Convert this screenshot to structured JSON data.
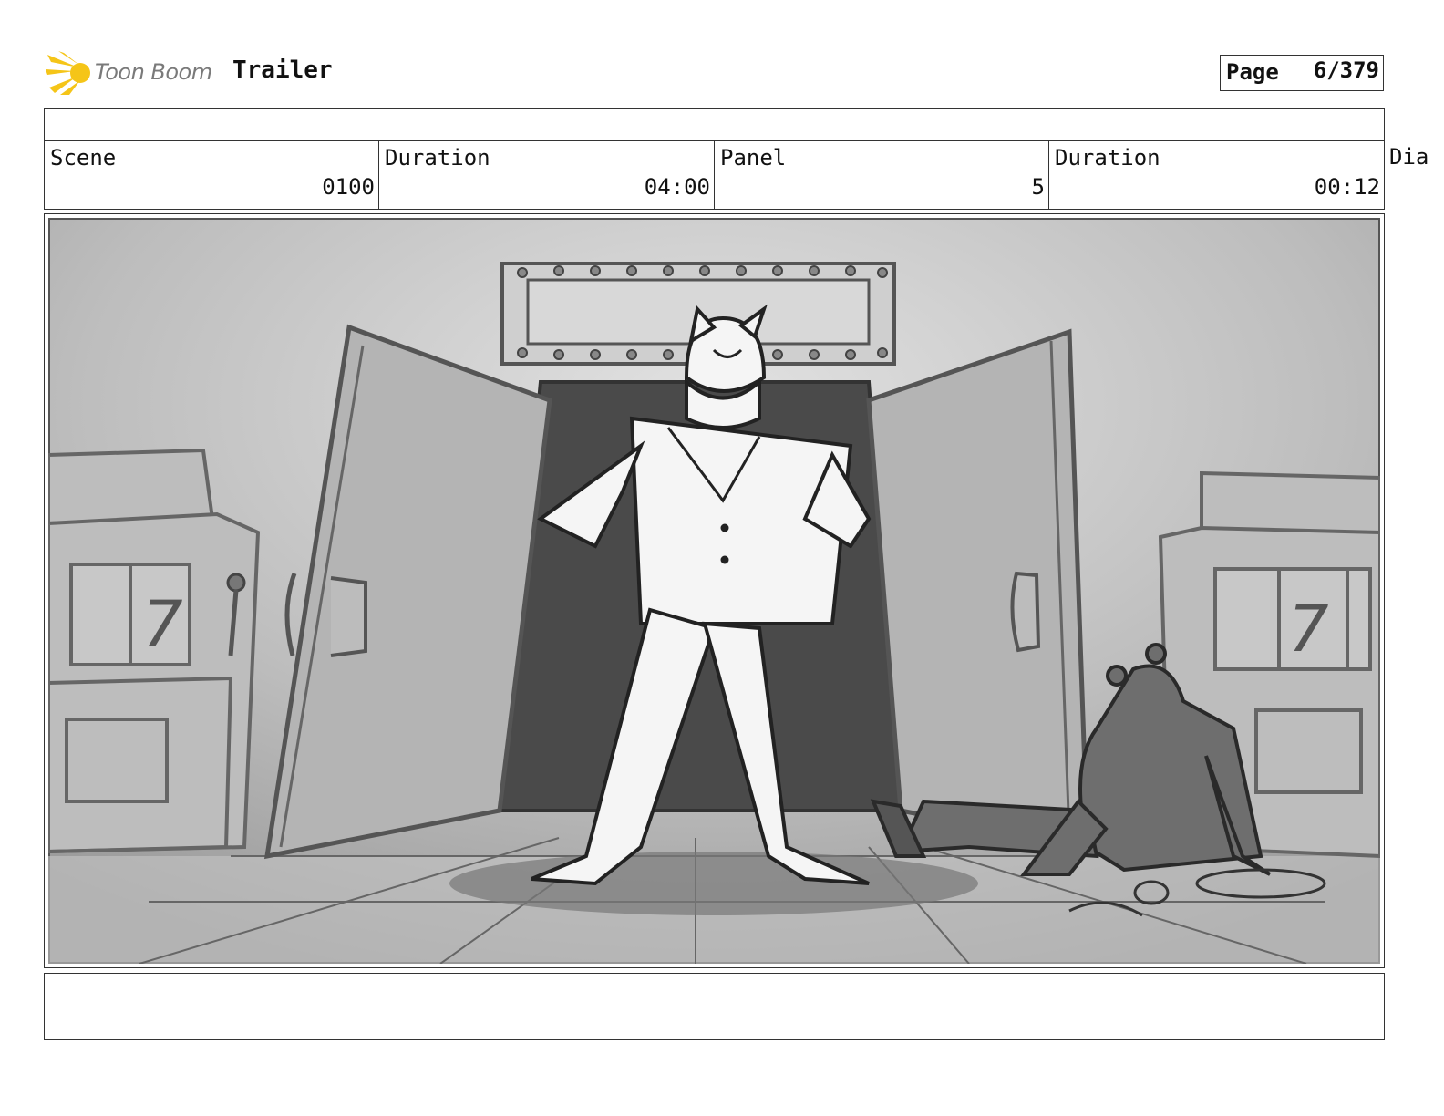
{
  "header": {
    "logo_text": "Toon Boom",
    "project_title": "Trailer",
    "page_label": "Page",
    "page_value": "6/379"
  },
  "info": {
    "scene_label": "Scene",
    "scene_value": "0100",
    "duration_label": "Duration",
    "duration_value": "04:00",
    "panel_label": "Panel",
    "panel_value": "5",
    "panel_duration_label": "Duration",
    "panel_duration_value": "00:12",
    "dialog_label": "Dia"
  },
  "colors": {
    "logo_yellow": "#f5c518",
    "border": "#333333"
  },
  "icons": {
    "logo": "toon-boom-burst-icon"
  }
}
